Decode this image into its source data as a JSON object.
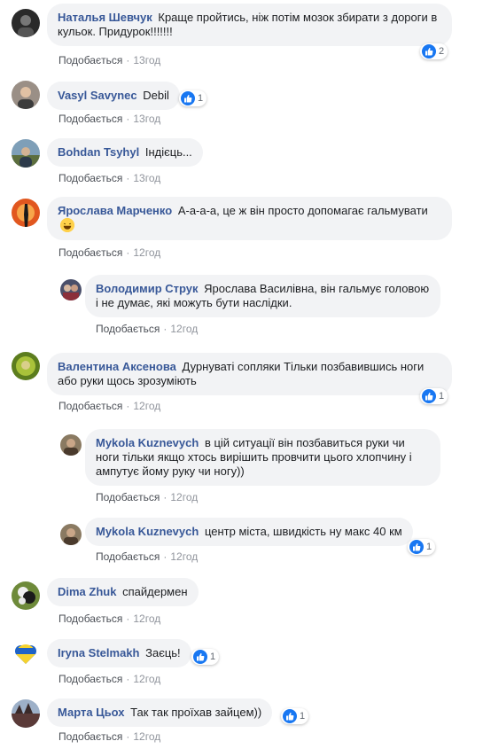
{
  "like_label": "Подобається",
  "colors": {
    "author": "#385898",
    "bubble": "#f2f3f5",
    "meta": "#90949c",
    "like": "#1877f2"
  },
  "comments": [
    {
      "author": "Наталья Шевчук",
      "text": "Краще пройтись, ніж потім мозок збирати з дороги в кульок. Придурок!!!!!!!",
      "time": "13год",
      "reactions": "2"
    },
    {
      "author": "Vasyl Savynec",
      "text": "Debil",
      "time": "13год",
      "reactions": "1"
    },
    {
      "author": "Bohdan Tsyhyl",
      "text": "Індієць...",
      "time": "13год"
    },
    {
      "author": "Ярослава Марченко",
      "text": "А-а-а-а, це ж він просто допомагає гальмувати",
      "emoji": "laughing-emoji",
      "time": "12год"
    },
    {
      "author": "Володимир Струк",
      "text": "Ярослава Василівна, він гальмує головою і не думає, які можуть бути наслідки.",
      "time": "12год"
    },
    {
      "author": "Валентина Аксенова",
      "text": "Дурнуваті сопляки Тільки позбавившись ноги або руки щось зрозуміють",
      "time": "12год",
      "reactions": "1"
    },
    {
      "author": "Mykola Kuznevych",
      "text": "в цій ситуації він позбавиться руки чи ноги тільки якщо хтось вирішить провчити цього хлопчину і ампутує йому руку чи ногу))",
      "time": "12год"
    },
    {
      "author": "Mykola Kuznevych",
      "text": "центр міста, швидкість ну макс 40 км",
      "time": "12год",
      "reactions": "1"
    },
    {
      "author": "Dima Zhuk",
      "text": "спайдермен",
      "time": "12год"
    },
    {
      "author": "Iryna Stelmakh",
      "text": "Заєць!",
      "time": "12год",
      "reactions": "1"
    },
    {
      "author": "Марта Цьох",
      "text": "Так так проїхав зайцем))",
      "time": "12год",
      "reactions": "1"
    }
  ]
}
